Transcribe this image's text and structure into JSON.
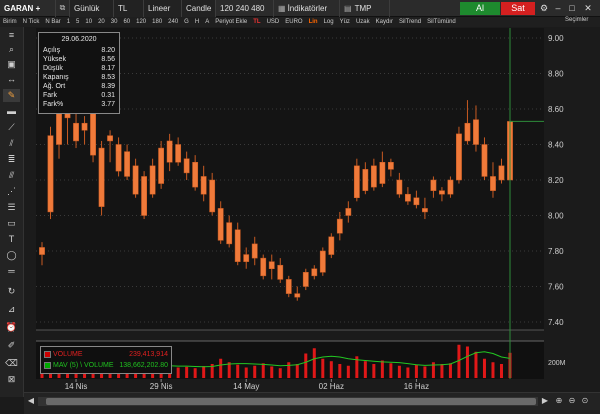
{
  "topbar": {
    "symbol": "GARAN",
    "add_icon": "+",
    "link_icon": "link-icon",
    "period": "Günlük",
    "currency": "TL",
    "scale": "Lineer",
    "chart_type": "Candle",
    "count": "120 240 480",
    "indicators": "İndikatörler",
    "template": "TMP",
    "buy_label": "Al",
    "sell_label": "Sat"
  },
  "toolbar2": {
    "items": [
      "Birim",
      "N Tick",
      "N Bar",
      "1",
      "5",
      "10",
      "20",
      "30",
      "60",
      "120",
      "180",
      "240",
      "G",
      "H",
      "A",
      "Periyot Ekle"
    ],
    "tl": "TL",
    "usd": "USD",
    "euro": "EURO",
    "lin": "Lin",
    "log": "Log",
    "yuz": "Yüz",
    "right_items": [
      "Uzak",
      "Kaydır",
      "SilTrend",
      "SilTümünd"
    ],
    "secimler": "Seçimler"
  },
  "info": {
    "date": "29.06.2020",
    "rows": [
      {
        "label": "Açılış",
        "value": "8.20"
      },
      {
        "label": "Yüksek",
        "value": "8.56"
      },
      {
        "label": "Düşük",
        "value": "8.17"
      },
      {
        "label": "Kapanış",
        "value": "8.53"
      },
      {
        "label": "Ağ. Ort",
        "value": "8.39"
      },
      {
        "label": "Fark",
        "value": "0.31"
      },
      {
        "label": "Fark%",
        "value": "3.77"
      }
    ]
  },
  "volume_legend": {
    "volume_label": "VOLUME",
    "volume_value": "239,413,914",
    "mav_label": "MAV (5) \\ VOLUME",
    "mav_value": "138,662,202.80"
  },
  "colors": {
    "candle": "#f07a3a",
    "candle_dark": "#c85a22",
    "volume": "#e01818",
    "mav": "#22c822",
    "crosshair": "#2e8b3a",
    "grid": "#3a3a3a"
  },
  "chart_data": {
    "type": "candlestick",
    "title": "",
    "y_ticks": [
      "9.00",
      "8.80",
      "8.60",
      "8.40",
      "8.20",
      "8.00",
      "7.80",
      "7.60",
      "7.40"
    ],
    "ylim": [
      7.4,
      9.0
    ],
    "x_ticks": [
      "14 Nis",
      "29 Nis",
      "14 May",
      "02 Haz",
      "16 Haz"
    ],
    "volume_tick": "200M",
    "candles": [
      {
        "o": 7.78,
        "h": 7.85,
        "l": 7.72,
        "c": 7.82
      },
      {
        "o": 8.02,
        "h": 8.5,
        "l": 7.98,
        "c": 8.45
      },
      {
        "o": 8.4,
        "h": 8.85,
        "l": 8.32,
        "c": 8.75
      },
      {
        "o": 8.55,
        "h": 8.7,
        "l": 8.4,
        "c": 8.62
      },
      {
        "o": 8.52,
        "h": 8.6,
        "l": 8.38,
        "c": 8.42
      },
      {
        "o": 8.48,
        "h": 8.56,
        "l": 8.4,
        "c": 8.52
      },
      {
        "o": 8.65,
        "h": 8.72,
        "l": 8.3,
        "c": 8.34
      },
      {
        "o": 8.38,
        "h": 8.42,
        "l": 8.0,
        "c": 8.05
      },
      {
        "o": 8.42,
        "h": 8.48,
        "l": 8.3,
        "c": 8.45
      },
      {
        "o": 8.4,
        "h": 8.44,
        "l": 8.22,
        "c": 8.25
      },
      {
        "o": 8.36,
        "h": 8.4,
        "l": 8.2,
        "c": 8.22
      },
      {
        "o": 8.28,
        "h": 8.32,
        "l": 8.1,
        "c": 8.12
      },
      {
        "o": 8.22,
        "h": 8.25,
        "l": 7.98,
        "c": 8.0
      },
      {
        "o": 8.28,
        "h": 8.32,
        "l": 8.1,
        "c": 8.12
      },
      {
        "o": 8.38,
        "h": 8.42,
        "l": 8.15,
        "c": 8.18
      },
      {
        "o": 8.3,
        "h": 8.46,
        "l": 8.25,
        "c": 8.42
      },
      {
        "o": 8.4,
        "h": 8.44,
        "l": 8.28,
        "c": 8.3
      },
      {
        "o": 8.24,
        "h": 8.36,
        "l": 8.2,
        "c": 8.32
      },
      {
        "o": 8.3,
        "h": 8.34,
        "l": 8.14,
        "c": 8.16
      },
      {
        "o": 8.12,
        "h": 8.28,
        "l": 8.08,
        "c": 8.22
      },
      {
        "o": 8.2,
        "h": 8.24,
        "l": 8.0,
        "c": 8.02
      },
      {
        "o": 8.04,
        "h": 8.08,
        "l": 7.84,
        "c": 7.86
      },
      {
        "o": 7.84,
        "h": 8.0,
        "l": 7.82,
        "c": 7.96
      },
      {
        "o": 7.92,
        "h": 7.96,
        "l": 7.72,
        "c": 7.74
      },
      {
        "o": 7.74,
        "h": 7.82,
        "l": 7.7,
        "c": 7.78
      },
      {
        "o": 7.84,
        "h": 7.88,
        "l": 7.72,
        "c": 7.76
      },
      {
        "o": 7.76,
        "h": 7.78,
        "l": 7.64,
        "c": 7.66
      },
      {
        "o": 7.7,
        "h": 7.78,
        "l": 7.64,
        "c": 7.74
      },
      {
        "o": 7.72,
        "h": 7.76,
        "l": 7.62,
        "c": 7.64
      },
      {
        "o": 7.64,
        "h": 7.66,
        "l": 7.54,
        "c": 7.56
      },
      {
        "o": 7.56,
        "h": 7.6,
        "l": 7.52,
        "c": 7.54
      },
      {
        "o": 7.6,
        "h": 7.7,
        "l": 7.58,
        "c": 7.68
      },
      {
        "o": 7.7,
        "h": 7.72,
        "l": 7.64,
        "c": 7.66
      },
      {
        "o": 7.68,
        "h": 7.82,
        "l": 7.66,
        "c": 7.8
      },
      {
        "o": 7.78,
        "h": 7.9,
        "l": 7.76,
        "c": 7.88
      },
      {
        "o": 7.9,
        "h": 8.02,
        "l": 7.86,
        "c": 7.98
      },
      {
        "o": 8.0,
        "h": 8.08,
        "l": 7.96,
        "c": 8.04
      },
      {
        "o": 8.1,
        "h": 8.32,
        "l": 8.08,
        "c": 8.28
      },
      {
        "o": 8.26,
        "h": 8.3,
        "l": 8.12,
        "c": 8.14
      },
      {
        "o": 8.16,
        "h": 8.32,
        "l": 8.14,
        "c": 8.28
      },
      {
        "o": 8.3,
        "h": 8.36,
        "l": 8.16,
        "c": 8.18
      },
      {
        "o": 8.26,
        "h": 8.32,
        "l": 8.22,
        "c": 8.3
      },
      {
        "o": 8.2,
        "h": 8.24,
        "l": 8.1,
        "c": 8.12
      },
      {
        "o": 8.12,
        "h": 8.16,
        "l": 8.06,
        "c": 8.08
      },
      {
        "o": 8.1,
        "h": 8.14,
        "l": 8.04,
        "c": 8.06
      },
      {
        "o": 8.04,
        "h": 8.1,
        "l": 7.98,
        "c": 8.02
      },
      {
        "o": 8.14,
        "h": 8.22,
        "l": 8.1,
        "c": 8.2
      },
      {
        "o": 8.14,
        "h": 8.16,
        "l": 8.08,
        "c": 8.12
      },
      {
        "o": 8.12,
        "h": 8.22,
        "l": 8.1,
        "c": 8.2
      },
      {
        "o": 8.2,
        "h": 8.5,
        "l": 8.18,
        "c": 8.46
      },
      {
        "o": 8.42,
        "h": 8.65,
        "l": 8.4,
        "c": 8.52
      },
      {
        "o": 8.54,
        "h": 8.62,
        "l": 8.36,
        "c": 8.4
      },
      {
        "o": 8.4,
        "h": 8.44,
        "l": 8.2,
        "c": 8.22
      },
      {
        "o": 8.22,
        "h": 8.3,
        "l": 8.1,
        "c": 8.14
      },
      {
        "o": 8.2,
        "h": 8.32,
        "l": 8.18,
        "c": 8.28
      },
      {
        "o": 8.2,
        "h": 8.56,
        "l": 8.17,
        "c": 8.53
      }
    ],
    "volume": [
      0.35,
      0.55,
      0.45,
      0.4,
      0.3,
      0.25,
      0.5,
      0.45,
      0.35,
      0.4,
      0.3,
      0.28,
      0.35,
      0.3,
      0.42,
      0.38,
      0.3,
      0.32,
      0.28,
      0.34,
      0.4,
      0.55,
      0.45,
      0.38,
      0.3,
      0.35,
      0.42,
      0.33,
      0.28,
      0.45,
      0.4,
      0.7,
      0.85,
      0.55,
      0.48,
      0.4,
      0.35,
      0.62,
      0.48,
      0.4,
      0.5,
      0.42,
      0.35,
      0.3,
      0.38,
      0.33,
      0.45,
      0.4,
      0.42,
      0.95,
      0.9,
      0.75,
      0.55,
      0.45,
      0.4,
      0.72
    ],
    "mav": [
      0.4,
      0.42,
      0.44,
      0.43,
      0.41,
      0.4,
      0.41,
      0.4,
      0.38,
      0.37,
      0.36,
      0.34,
      0.33,
      0.32,
      0.34,
      0.35,
      0.34,
      0.34,
      0.33,
      0.32,
      0.33,
      0.37,
      0.4,
      0.41,
      0.41,
      0.4,
      0.39,
      0.37,
      0.35,
      0.36,
      0.38,
      0.45,
      0.55,
      0.6,
      0.62,
      0.6,
      0.55,
      0.52,
      0.5,
      0.48,
      0.46,
      0.45,
      0.44,
      0.41,
      0.38,
      0.36,
      0.37,
      0.38,
      0.4,
      0.5,
      0.62,
      0.72,
      0.75,
      0.7,
      0.6,
      0.56
    ]
  }
}
